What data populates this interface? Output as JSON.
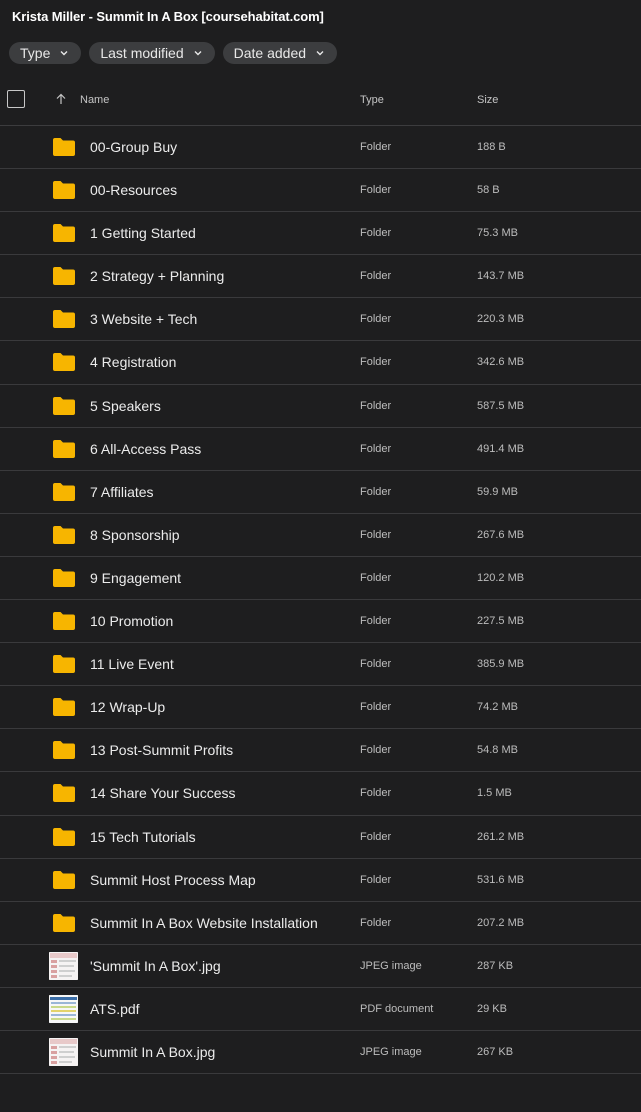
{
  "title": "Krista Miller - Summit In A Box [coursehabitat.com]",
  "filters": [
    {
      "label": "Type"
    },
    {
      "label": "Last modified"
    },
    {
      "label": "Date added"
    }
  ],
  "columns": {
    "name": "Name",
    "type": "Type",
    "size": "Size"
  },
  "colors": {
    "folder": "#f7b500",
    "background": "#1e1e1f",
    "chip": "#3c3d3f"
  },
  "rows": [
    {
      "kind": "folder",
      "name": "00-Group Buy",
      "type": "Folder",
      "size": "188 B"
    },
    {
      "kind": "folder",
      "name": "00-Resources",
      "type": "Folder",
      "size": "58 B"
    },
    {
      "kind": "folder",
      "name": "1 Getting Started",
      "type": "Folder",
      "size": "75.3 MB"
    },
    {
      "kind": "folder",
      "name": "2 Strategy + Planning",
      "type": "Folder",
      "size": "143.7 MB"
    },
    {
      "kind": "folder",
      "name": "3 Website + Tech",
      "type": "Folder",
      "size": "220.3 MB"
    },
    {
      "kind": "folder",
      "name": "4 Registration",
      "type": "Folder",
      "size": "342.6 MB"
    },
    {
      "kind": "folder",
      "name": "5 Speakers",
      "type": "Folder",
      "size": "587.5 MB"
    },
    {
      "kind": "folder",
      "name": "6 All-Access Pass",
      "type": "Folder",
      "size": "491.4 MB"
    },
    {
      "kind": "folder",
      "name": "7 Affiliates",
      "type": "Folder",
      "size": "59.9 MB"
    },
    {
      "kind": "folder",
      "name": "8 Sponsorship",
      "type": "Folder",
      "size": "267.6 MB"
    },
    {
      "kind": "folder",
      "name": "9 Engagement",
      "type": "Folder",
      "size": "120.2 MB"
    },
    {
      "kind": "folder",
      "name": "10 Promotion",
      "type": "Folder",
      "size": "227.5 MB"
    },
    {
      "kind": "folder",
      "name": "11 Live Event",
      "type": "Folder",
      "size": "385.9 MB"
    },
    {
      "kind": "folder",
      "name": "12 Wrap-Up",
      "type": "Folder",
      "size": "74.2 MB"
    },
    {
      "kind": "folder",
      "name": "13 Post-Summit Profits",
      "type": "Folder",
      "size": "54.8 MB"
    },
    {
      "kind": "folder",
      "name": "14 Share Your Success",
      "type": "Folder",
      "size": "1.5 MB"
    },
    {
      "kind": "folder",
      "name": "15 Tech Tutorials",
      "type": "Folder",
      "size": "261.2 MB"
    },
    {
      "kind": "folder",
      "name": "Summit Host Process Map",
      "type": "Folder",
      "size": "531.6 MB"
    },
    {
      "kind": "folder",
      "name": "Summit In A Box Website Installation",
      "type": "Folder",
      "size": "207.2 MB"
    },
    {
      "kind": "jpeg",
      "name": "'Summit In A Box'.jpg",
      "type": "JPEG image",
      "size": "287 KB"
    },
    {
      "kind": "pdf",
      "name": "ATS.pdf",
      "type": "PDF document",
      "size": "29 KB"
    },
    {
      "kind": "jpeg",
      "name": "Summit In A Box.jpg",
      "type": "JPEG image",
      "size": "267 KB"
    }
  ]
}
